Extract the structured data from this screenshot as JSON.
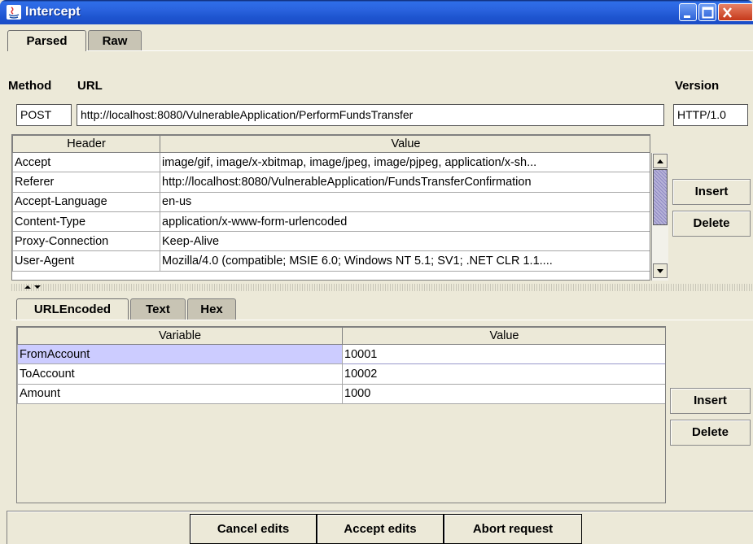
{
  "window": {
    "title": "Intercept"
  },
  "tabs_top": [
    "Parsed",
    "Raw"
  ],
  "request": {
    "method_label": "Method",
    "url_label": "URL",
    "version_label": "Version",
    "method": "POST",
    "url": "http://localhost:8080/VulnerableApplication/PerformFundsTransfer",
    "version": "HTTP/1.0"
  },
  "headers_table": {
    "columns": [
      "Header",
      "Value"
    ],
    "rows": [
      [
        "Accept",
        "image/gif, image/x-xbitmap, image/jpeg, image/pjpeg, application/x-sh..."
      ],
      [
        "Referer",
        "http://localhost:8080/VulnerableApplication/FundsTransferConfirmation"
      ],
      [
        "Accept-Language",
        "en-us"
      ],
      [
        "Content-Type",
        "application/x-www-form-urlencoded"
      ],
      [
        "Proxy-Connection",
        "Keep-Alive"
      ],
      [
        "User-Agent",
        "Mozilla/4.0 (compatible; MSIE 6.0; Windows NT 5.1; SV1; .NET CLR 1.1...."
      ]
    ],
    "insert_label": "Insert",
    "delete_label": "Delete"
  },
  "tabs_body": [
    "URLEncoded",
    "Text",
    "Hex"
  ],
  "vars_table": {
    "columns": [
      "Variable",
      "Value"
    ],
    "rows": [
      [
        "FromAccount",
        "10001"
      ],
      [
        "ToAccount",
        "10002"
      ],
      [
        "Amount",
        "1000"
      ]
    ],
    "insert_label": "Insert",
    "delete_label": "Delete"
  },
  "footer": {
    "cancel_label": "Cancel edits",
    "accept_label": "Accept edits",
    "abort_label": "Abort request"
  },
  "colors": {
    "titlebar": "#2a63de",
    "selected_row": "#ccccff",
    "window_bg": "#ece9d8"
  }
}
